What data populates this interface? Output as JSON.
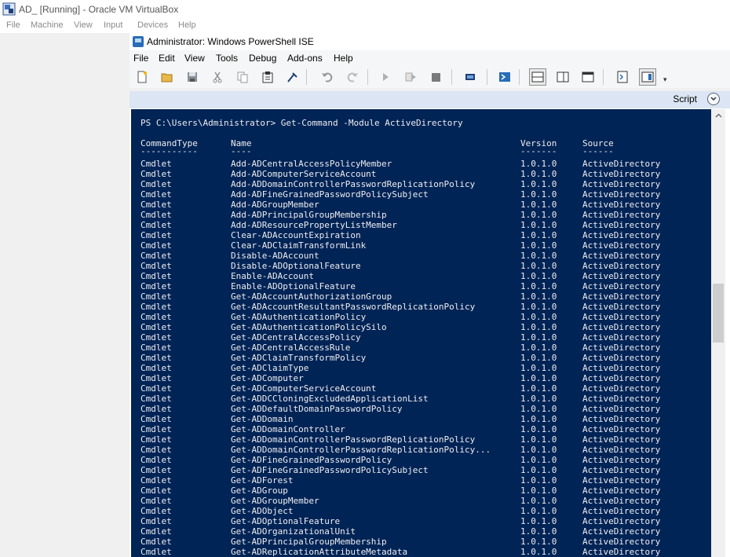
{
  "vbox": {
    "title": "AD_ [Running] - Oracle VM VirtualBox",
    "menu": [
      "File",
      "Machine",
      "View",
      "Input",
      "Devices",
      "Help"
    ]
  },
  "ise": {
    "title": "Administrator: Windows PowerShell ISE",
    "menu": [
      "File",
      "Edit",
      "View",
      "Tools",
      "Debug",
      "Add-ons",
      "Help"
    ],
    "toolbar_icons": [
      "new-file-icon",
      "open-folder-icon",
      "save-icon",
      "cut-icon",
      "copy-icon",
      "paste-icon",
      "clear-console-icon",
      "undo-icon",
      "redo-icon",
      "run-icon",
      "run-selection-icon",
      "stop-icon",
      "remote-session-icon",
      "powershell-icon",
      "layout-top-icon",
      "layout-right-icon",
      "layout-max-icon",
      "show-command-icon",
      "command-addon-icon"
    ],
    "script_label": "Script"
  },
  "console": {
    "prompt": "PS C:\\Users\\Administrator> Get-Command -Module ActiveDirectory",
    "headers": [
      "CommandType",
      "Name",
      "Version",
      "Source"
    ],
    "underlines": [
      "-----------",
      "----",
      "-------",
      "------"
    ],
    "rows": [
      [
        "Cmdlet",
        "Add-ADCentralAccessPolicyMember",
        "1.0.1.0",
        "ActiveDirectory"
      ],
      [
        "Cmdlet",
        "Add-ADComputerServiceAccount",
        "1.0.1.0",
        "ActiveDirectory"
      ],
      [
        "Cmdlet",
        "Add-ADDomainControllerPasswordReplicationPolicy",
        "1.0.1.0",
        "ActiveDirectory"
      ],
      [
        "Cmdlet",
        "Add-ADFineGrainedPasswordPolicySubject",
        "1.0.1.0",
        "ActiveDirectory"
      ],
      [
        "Cmdlet",
        "Add-ADGroupMember",
        "1.0.1.0",
        "ActiveDirectory"
      ],
      [
        "Cmdlet",
        "Add-ADPrincipalGroupMembership",
        "1.0.1.0",
        "ActiveDirectory"
      ],
      [
        "Cmdlet",
        "Add-ADResourcePropertyListMember",
        "1.0.1.0",
        "ActiveDirectory"
      ],
      [
        "Cmdlet",
        "Clear-ADAccountExpiration",
        "1.0.1.0",
        "ActiveDirectory"
      ],
      [
        "Cmdlet",
        "Clear-ADClaimTransformLink",
        "1.0.1.0",
        "ActiveDirectory"
      ],
      [
        "Cmdlet",
        "Disable-ADAccount",
        "1.0.1.0",
        "ActiveDirectory"
      ],
      [
        "Cmdlet",
        "Disable-ADOptionalFeature",
        "1.0.1.0",
        "ActiveDirectory"
      ],
      [
        "Cmdlet",
        "Enable-ADAccount",
        "1.0.1.0",
        "ActiveDirectory"
      ],
      [
        "Cmdlet",
        "Enable-ADOptionalFeature",
        "1.0.1.0",
        "ActiveDirectory"
      ],
      [
        "Cmdlet",
        "Get-ADAccountAuthorizationGroup",
        "1.0.1.0",
        "ActiveDirectory"
      ],
      [
        "Cmdlet",
        "Get-ADAccountResultantPasswordReplicationPolicy",
        "1.0.1.0",
        "ActiveDirectory"
      ],
      [
        "Cmdlet",
        "Get-ADAuthenticationPolicy",
        "1.0.1.0",
        "ActiveDirectory"
      ],
      [
        "Cmdlet",
        "Get-ADAuthenticationPolicySilo",
        "1.0.1.0",
        "ActiveDirectory"
      ],
      [
        "Cmdlet",
        "Get-ADCentralAccessPolicy",
        "1.0.1.0",
        "ActiveDirectory"
      ],
      [
        "Cmdlet",
        "Get-ADCentralAccessRule",
        "1.0.1.0",
        "ActiveDirectory"
      ],
      [
        "Cmdlet",
        "Get-ADClaimTransformPolicy",
        "1.0.1.0",
        "ActiveDirectory"
      ],
      [
        "Cmdlet",
        "Get-ADClaimType",
        "1.0.1.0",
        "ActiveDirectory"
      ],
      [
        "Cmdlet",
        "Get-ADComputer",
        "1.0.1.0",
        "ActiveDirectory"
      ],
      [
        "Cmdlet",
        "Get-ADComputerServiceAccount",
        "1.0.1.0",
        "ActiveDirectory"
      ],
      [
        "Cmdlet",
        "Get-ADDCCloningExcludedApplicationList",
        "1.0.1.0",
        "ActiveDirectory"
      ],
      [
        "Cmdlet",
        "Get-ADDefaultDomainPasswordPolicy",
        "1.0.1.0",
        "ActiveDirectory"
      ],
      [
        "Cmdlet",
        "Get-ADDomain",
        "1.0.1.0",
        "ActiveDirectory"
      ],
      [
        "Cmdlet",
        "Get-ADDomainController",
        "1.0.1.0",
        "ActiveDirectory"
      ],
      [
        "Cmdlet",
        "Get-ADDomainControllerPasswordReplicationPolicy",
        "1.0.1.0",
        "ActiveDirectory"
      ],
      [
        "Cmdlet",
        "Get-ADDomainControllerPasswordReplicationPolicy...",
        "1.0.1.0",
        "ActiveDirectory"
      ],
      [
        "Cmdlet",
        "Get-ADFineGrainedPasswordPolicy",
        "1.0.1.0",
        "ActiveDirectory"
      ],
      [
        "Cmdlet",
        "Get-ADFineGrainedPasswordPolicySubject",
        "1.0.1.0",
        "ActiveDirectory"
      ],
      [
        "Cmdlet",
        "Get-ADForest",
        "1.0.1.0",
        "ActiveDirectory"
      ],
      [
        "Cmdlet",
        "Get-ADGroup",
        "1.0.1.0",
        "ActiveDirectory"
      ],
      [
        "Cmdlet",
        "Get-ADGroupMember",
        "1.0.1.0",
        "ActiveDirectory"
      ],
      [
        "Cmdlet",
        "Get-ADObject",
        "1.0.1.0",
        "ActiveDirectory"
      ],
      [
        "Cmdlet",
        "Get-ADOptionalFeature",
        "1.0.1.0",
        "ActiveDirectory"
      ],
      [
        "Cmdlet",
        "Get-ADOrganizationalUnit",
        "1.0.1.0",
        "ActiveDirectory"
      ],
      [
        "Cmdlet",
        "Get-ADPrincipalGroupMembership",
        "1.0.1.0",
        "ActiveDirectory"
      ],
      [
        "Cmdlet",
        "Get-ADReplicationAttributeMetadata",
        "1.0.1.0",
        "ActiveDirectory"
      ]
    ]
  },
  "colors": {
    "console_bg": "#012456",
    "console_fg": "#eeedf0",
    "script_bar": "#dbe5f3"
  }
}
